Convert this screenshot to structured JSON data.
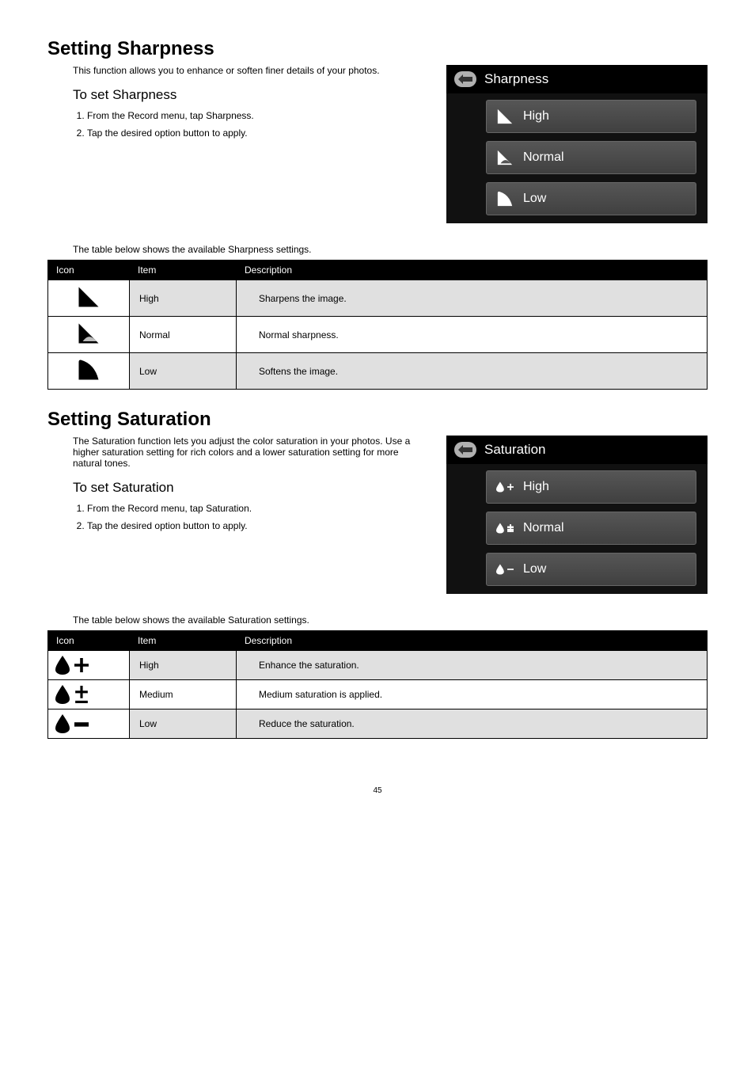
{
  "sharpness": {
    "title": "Setting Sharpness",
    "intro": "This function allows you to enhance or soften finer details of your photos.",
    "subtitle": "To set Sharpness",
    "steps": [
      "From the Record menu, tap Sharpness.",
      "Tap the desired option button to apply."
    ],
    "panel_title": "Sharpness",
    "panel_items": [
      "High",
      "Normal",
      "Low"
    ],
    "table_intro": "The table below shows the available Sharpness settings.",
    "table_headers": {
      "icon": "Icon",
      "item": "Item",
      "description": "Description"
    },
    "rows": [
      {
        "item": "High",
        "description": "Sharpens the image."
      },
      {
        "item": "Normal",
        "description": "Normal sharpness."
      },
      {
        "item": "Low",
        "description": "Softens the image."
      }
    ]
  },
  "saturation": {
    "title": "Setting Saturation",
    "intro": "The Saturation function lets you adjust the color saturation in your photos. Use a higher saturation setting for rich colors and a lower saturation setting for more natural tones.",
    "subtitle": "To set Saturation",
    "steps": [
      "From the Record menu, tap Saturation.",
      "Tap the desired option button to apply."
    ],
    "panel_title": "Saturation",
    "panel_items": [
      "High",
      "Normal",
      "Low"
    ],
    "table_intro": "The table below shows the available Saturation settings.",
    "table_headers": {
      "icon": "Icon",
      "item": "Item",
      "description": "Description"
    },
    "rows": [
      {
        "item": "High",
        "description": "Enhance the saturation."
      },
      {
        "item": "Medium",
        "description": "Medium saturation is applied."
      },
      {
        "item": "Low",
        "description": "Reduce the saturation."
      }
    ]
  },
  "page_number": "45"
}
